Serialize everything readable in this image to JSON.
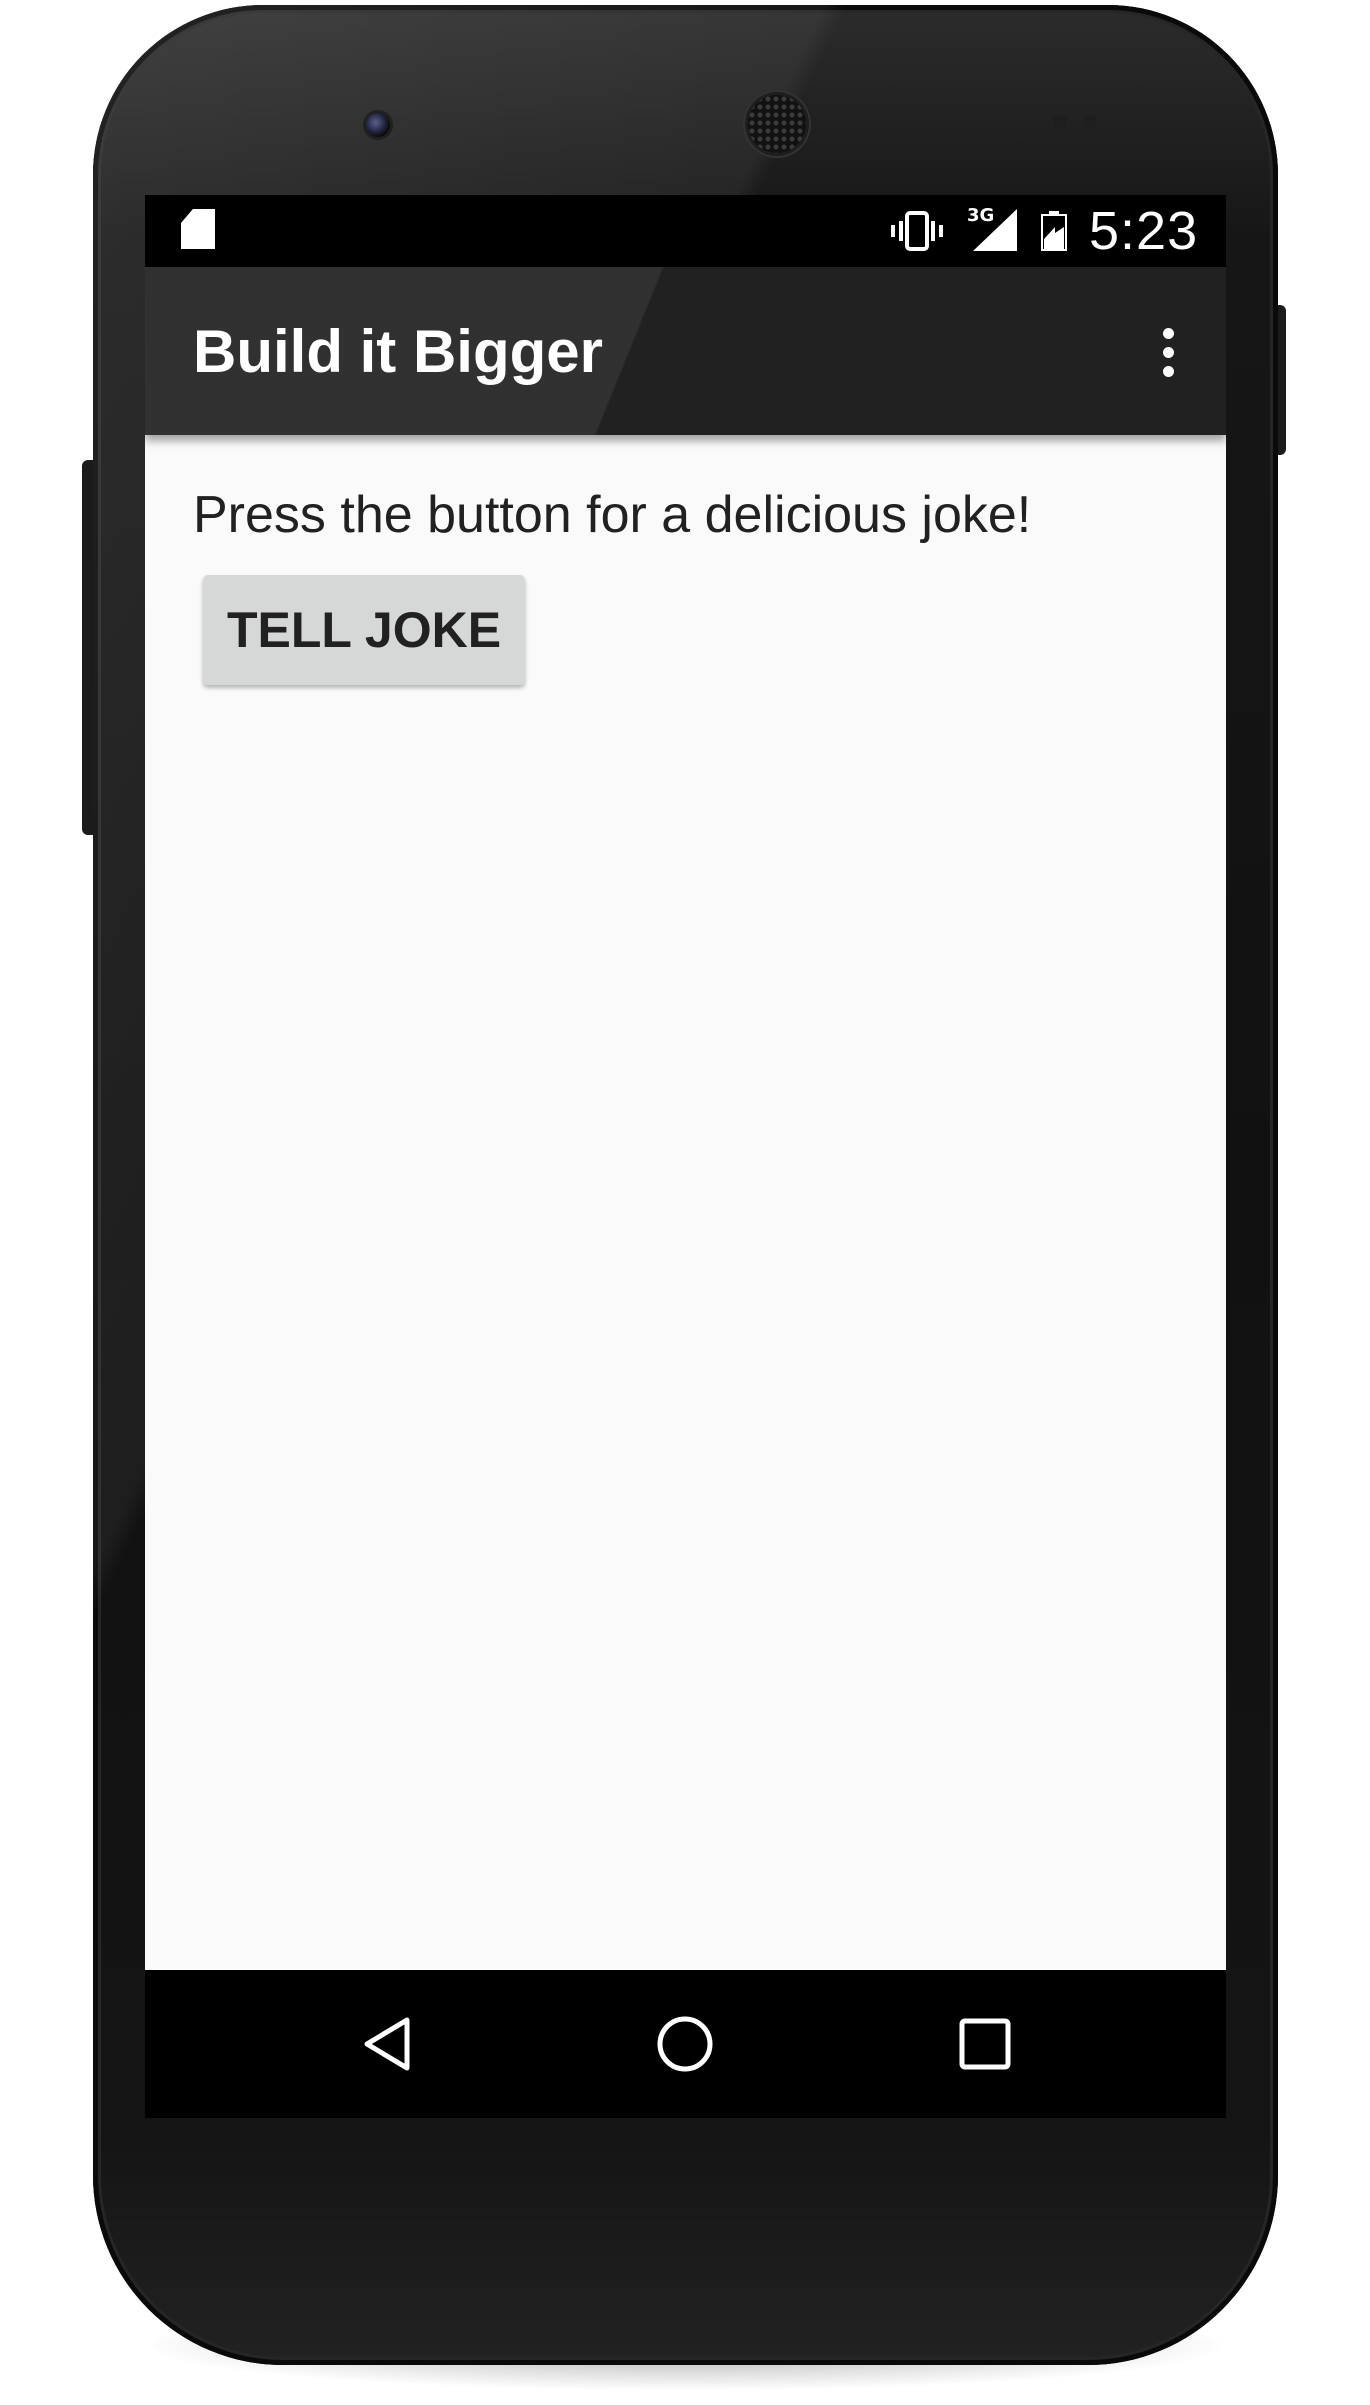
{
  "status_bar": {
    "time": "5:23",
    "network_type": "3G",
    "icons": [
      "sd-card-icon",
      "vibrate-icon",
      "signal-icon",
      "battery-icon"
    ]
  },
  "app_bar": {
    "title": "Build it Bigger",
    "overflow_icon": "more-vert-icon"
  },
  "main": {
    "prompt_text": "Press the button for a delicious joke!",
    "tell_joke_label": "TELL JOKE"
  },
  "nav_bar": {
    "items": [
      "back-icon",
      "home-icon",
      "recents-icon"
    ]
  },
  "colors": {
    "app_bar": "#212121",
    "content_background": "#fafafa",
    "button_background": "#d6d7d7",
    "text_primary": "#212121"
  }
}
